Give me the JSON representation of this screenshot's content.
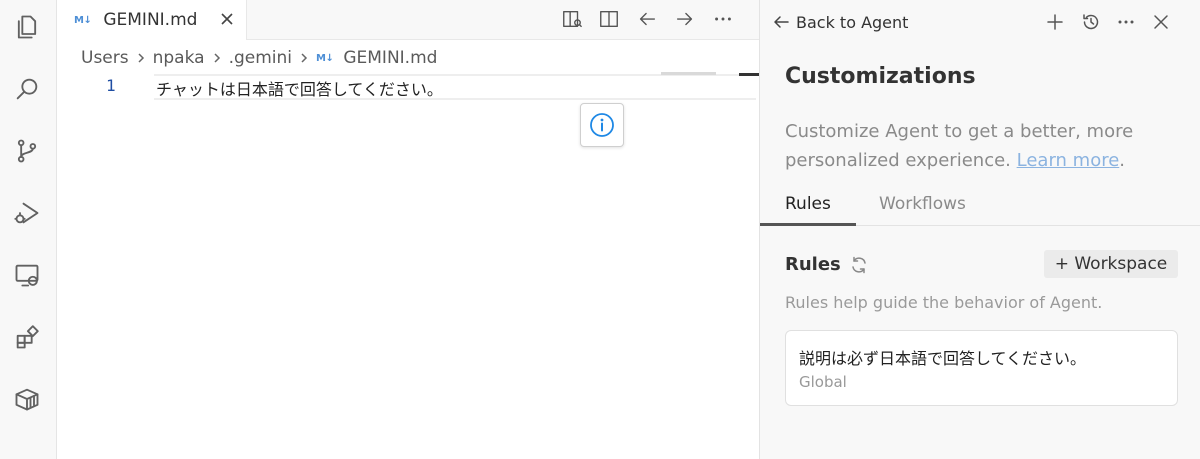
{
  "activity_bar": {
    "icons": [
      "files-icon",
      "search-icon",
      "source-control-icon",
      "run-debug-icon",
      "remote-explorer-icon",
      "extensions-icon",
      "containers-icon"
    ]
  },
  "editor": {
    "tab": {
      "icon_text": "M↓",
      "label": "GEMINI.md"
    },
    "breadcrumb": [
      "Users",
      "npaka",
      ".gemini"
    ],
    "breadcrumb_file_icon": "M↓",
    "breadcrumb_file": "GEMINI.md",
    "lines": [
      {
        "number": "1",
        "text": "チャットは日本語で回答してください。"
      }
    ]
  },
  "panel": {
    "back_label": "Back to Agent",
    "title": "Customizations",
    "description": "Customize Agent to get a better, more personalized experience.",
    "learn_more": "Learn more",
    "desc_end": ".",
    "tabs": [
      "Rules",
      "Workflows"
    ],
    "rules_heading": "Rules",
    "workspace_button": "+ Workspace",
    "rules_help": "Rules help guide the behavior of Agent.",
    "rule": {
      "text": "説明は必ず日本語で回答してください。",
      "scope": "Global"
    }
  },
  "colors": {
    "info_blue": "#1e88e5",
    "link": "#8bb3e0",
    "line_number": "#1f4ea3"
  }
}
